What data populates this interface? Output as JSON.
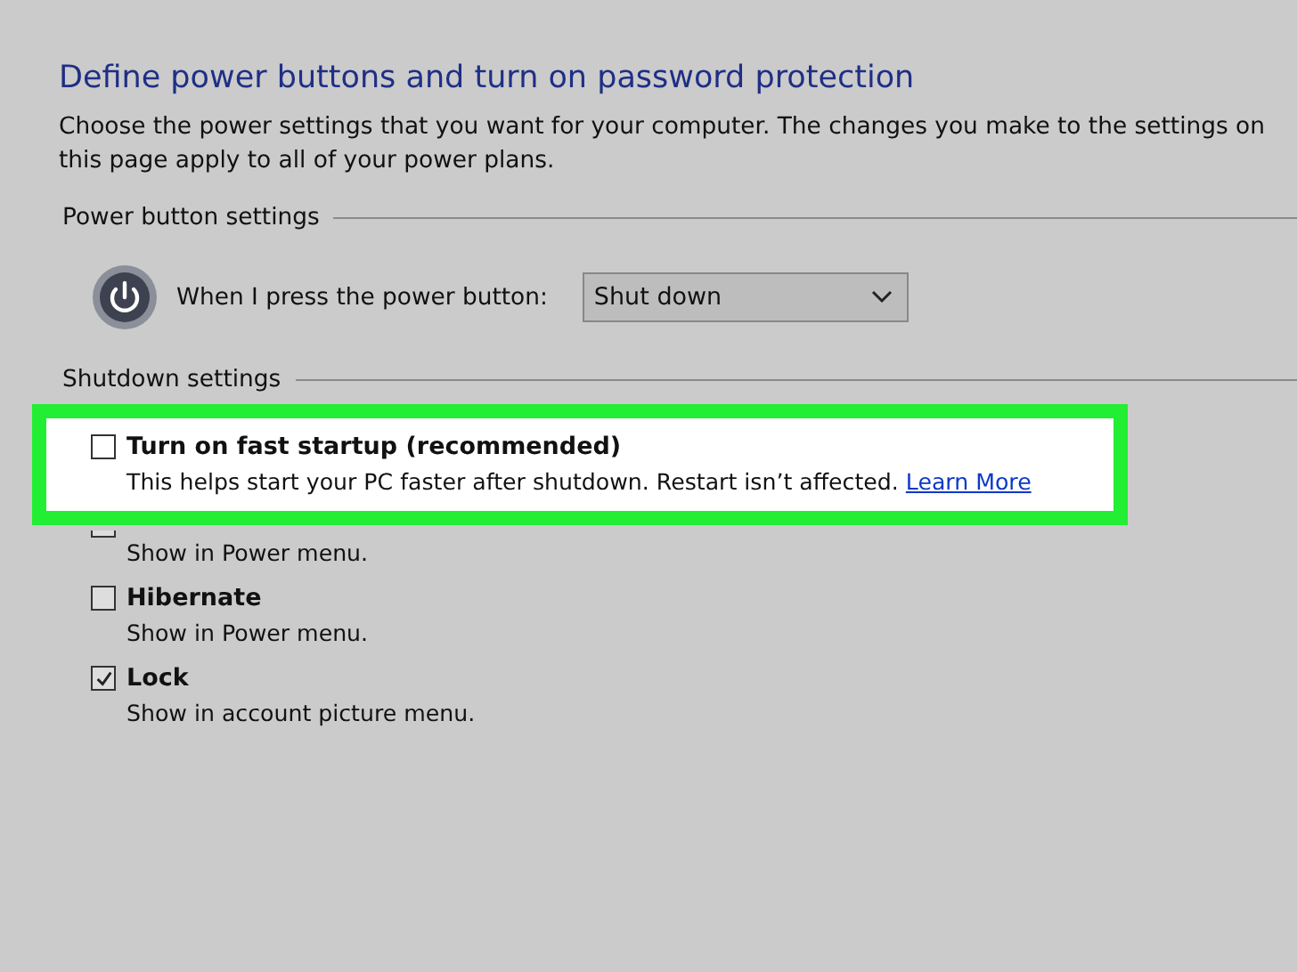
{
  "heading": "Define power buttons and turn on password protection",
  "intro": "Choose the power settings that you want for your computer. The changes you make to the settings on this page apply to all of your power plans.",
  "power_button_settings": {
    "title": "Power button settings",
    "label": "When I press the power button:",
    "value": "Shut down"
  },
  "shutdown_settings": {
    "title": "Shutdown settings",
    "options": [
      {
        "label": "Turn on fast startup (recommended)",
        "description": "This helps start your PC faster after shutdown. Restart isn’t affected.",
        "link": "Learn More",
        "checked": false,
        "highlighted": true
      },
      {
        "description": "Show in Power menu.",
        "highlighted": false
      },
      {
        "label": "Hibernate",
        "description": "Show in Power menu.",
        "checked": false,
        "highlighted": false
      },
      {
        "label": "Lock",
        "description": "Show in account picture menu.",
        "checked": true,
        "highlighted": false
      }
    ]
  }
}
